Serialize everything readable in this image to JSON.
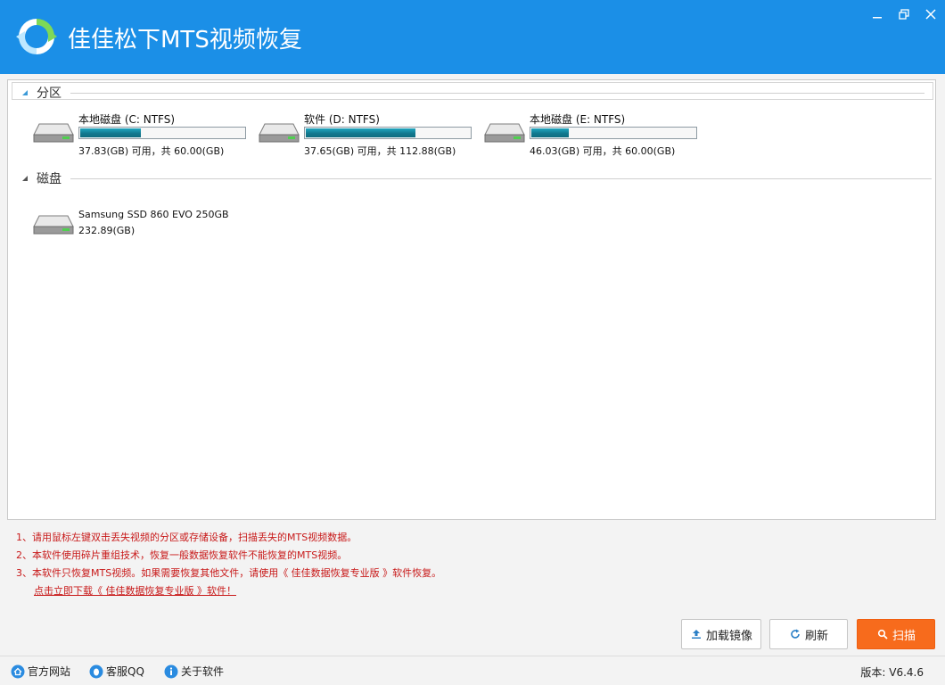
{
  "app": {
    "title": "佳佳松下MTS视频恢复"
  },
  "sections": {
    "partitions_label": "分区",
    "disks_label": "磁盘"
  },
  "partitions": [
    {
      "name": "本地磁盘 (C: NTFS)",
      "free_text": "37.83(GB) 可用，共 60.00(GB)",
      "used_fraction": 0.37
    },
    {
      "name": "软件 (D: NTFS)",
      "free_text": "37.65(GB) 可用，共 112.88(GB)",
      "used_fraction": 0.67
    },
    {
      "name": "本地磁盘 (E: NTFS)",
      "free_text": "46.03(GB) 可用，共 60.00(GB)",
      "used_fraction": 0.23
    }
  ],
  "disks": [
    {
      "name": "Samsung SSD 860 EVO 250GB",
      "size": "232.89(GB)"
    }
  ],
  "notices": [
    "1、请用鼠标左键双击丢失视频的分区或存储设备，扫描丢失的MTS视频数据。",
    "2、本软件使用碎片重组技术，恢复一般数据恢复软件不能恢复的MTS视频。",
    "3、本软件只恢复MTS视频。如果需要恢复其他文件，请使用《 佳佳数据恢复专业版 》软件恢复。"
  ],
  "notice_link": "点击立即下载《 佳佳数据恢复专业版 》软件！",
  "buttons": {
    "load_image": "加载镜像",
    "refresh": "刷新",
    "scan": "扫描"
  },
  "footer": {
    "website": "官方网站",
    "qq": "客服QQ",
    "about": "关于软件",
    "version": "版本: V6.4.6"
  },
  "colors": {
    "titlebar": "#1b8fe7",
    "scan_button": "#f76b1c",
    "notice_text": "#c81919",
    "usage_bar": "#12798f"
  },
  "icons": [
    "logo-icon",
    "minimize-icon",
    "maximize-icon",
    "close-icon",
    "hard-disk-icon",
    "upload-icon",
    "refresh-icon",
    "search-icon",
    "home-icon",
    "qq-icon",
    "info-icon"
  ]
}
